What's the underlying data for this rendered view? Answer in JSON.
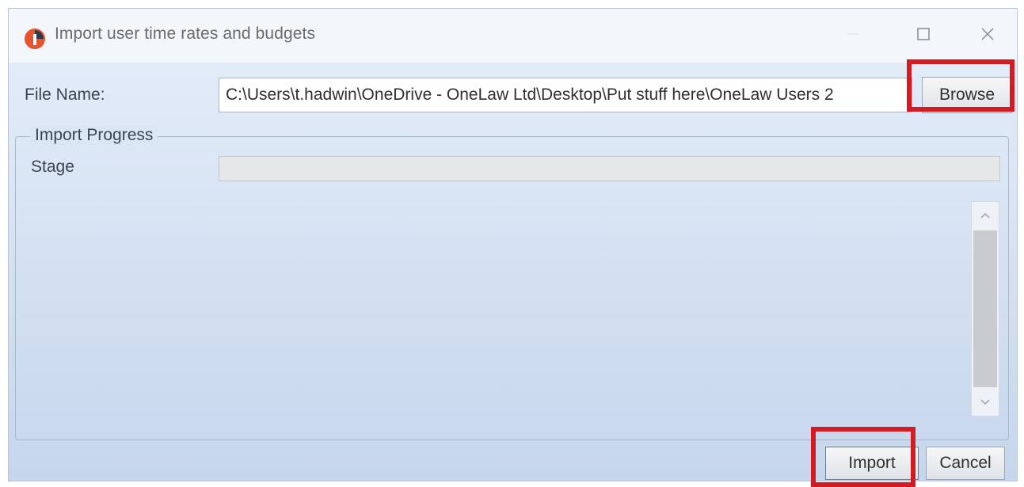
{
  "window": {
    "title": "Import user time rates and budgets",
    "controls": {
      "minimize_icon": "minimize-icon",
      "maximize_icon": "maximize-icon",
      "close_icon": "close-icon"
    }
  },
  "form": {
    "file_name_label": "File Name:",
    "file_name_value": "C:\\Users\\t.hadwin\\OneDrive - OneLaw Ltd\\Desktop\\Put stuff here\\OneLaw Users 2",
    "browse_label": "Browse"
  },
  "progress_group": {
    "title": "Import Progress",
    "stage_label": "Stage",
    "stage_progress": 0
  },
  "footer": {
    "import_label": "Import",
    "cancel_label": "Cancel"
  },
  "colors": {
    "highlight": "#d31b23",
    "app_icon_primary": "#e8532f",
    "app_icon_dark": "#2b3a4a"
  }
}
